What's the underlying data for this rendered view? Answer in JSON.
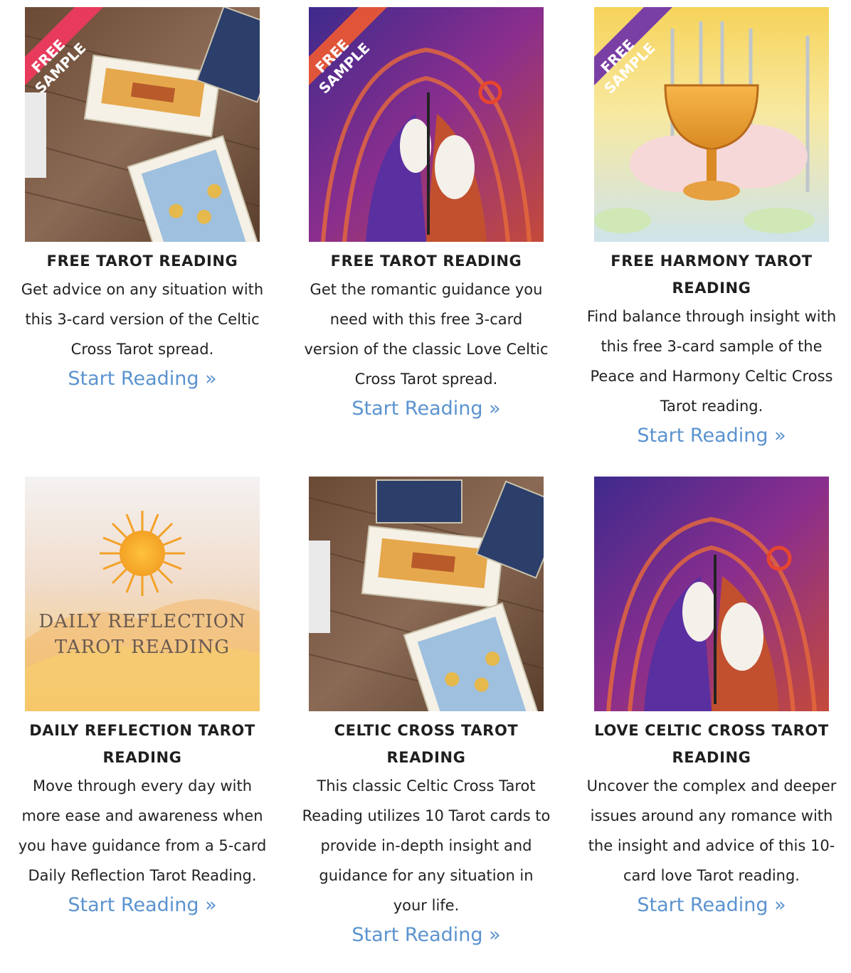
{
  "ribbon": {
    "line1": "FREE",
    "line2": "SAMPLE"
  },
  "daily_image_text": {
    "line1": "DAILY REFLECTION",
    "line2": "TAROT READING"
  },
  "cta_label": "Start Reading »",
  "colors": {
    "ribbon_red": "#e83a5b",
    "ribbon_orange": "#e0553a",
    "ribbon_purple": "#7a3fa5",
    "link_blue": "#5b93cf"
  },
  "cards": [
    {
      "title": "FREE TAROT READING",
      "description": "Get advice on any situation with this 3-card version of the Celtic Cross Tarot spread.",
      "cta": "Start Reading »",
      "image": "tarot-cards-on-wood",
      "ribbon": true
    },
    {
      "title": "FREE TAROT READING",
      "description": "Get the romantic guidance you need with this free 3-card version of the classic Love Celtic Cross Tarot spread.",
      "cta": "Start Reading »",
      "image": "lovers-art-deco",
      "ribbon": true
    },
    {
      "title": "FREE HARMONY TAROT READING",
      "description": "Find balance through insight with this free 3-card sample of the Peace and Harmony Celtic Cross Tarot reading.",
      "cta": "Start Reading »",
      "image": "golden-chalice",
      "ribbon": true
    },
    {
      "title": "DAILY REFLECTION TAROT READING",
      "description": "Move through every day with more ease and awareness when you have guidance from a 5-card Daily Reflection Tarot Reading.",
      "cta": "Start Reading »",
      "image": "sun-over-hills",
      "ribbon": false
    },
    {
      "title": "CELTIC CROSS TAROT READING",
      "description": "This classic Celtic Cross Tarot Reading utilizes 10 Tarot cards to provide in-depth insight and guidance for any situation in your life.",
      "cta": "Start Reading »",
      "image": "tarot-cards-on-wood",
      "ribbon": false
    },
    {
      "title": "LOVE CELTIC CROSS TAROT READING",
      "description": "Uncover the complex and deeper issues around any romance with the insight and advice of this 10-card love Tarot reading.",
      "cta": "Start Reading »",
      "image": "lovers-art-deco",
      "ribbon": false
    }
  ]
}
